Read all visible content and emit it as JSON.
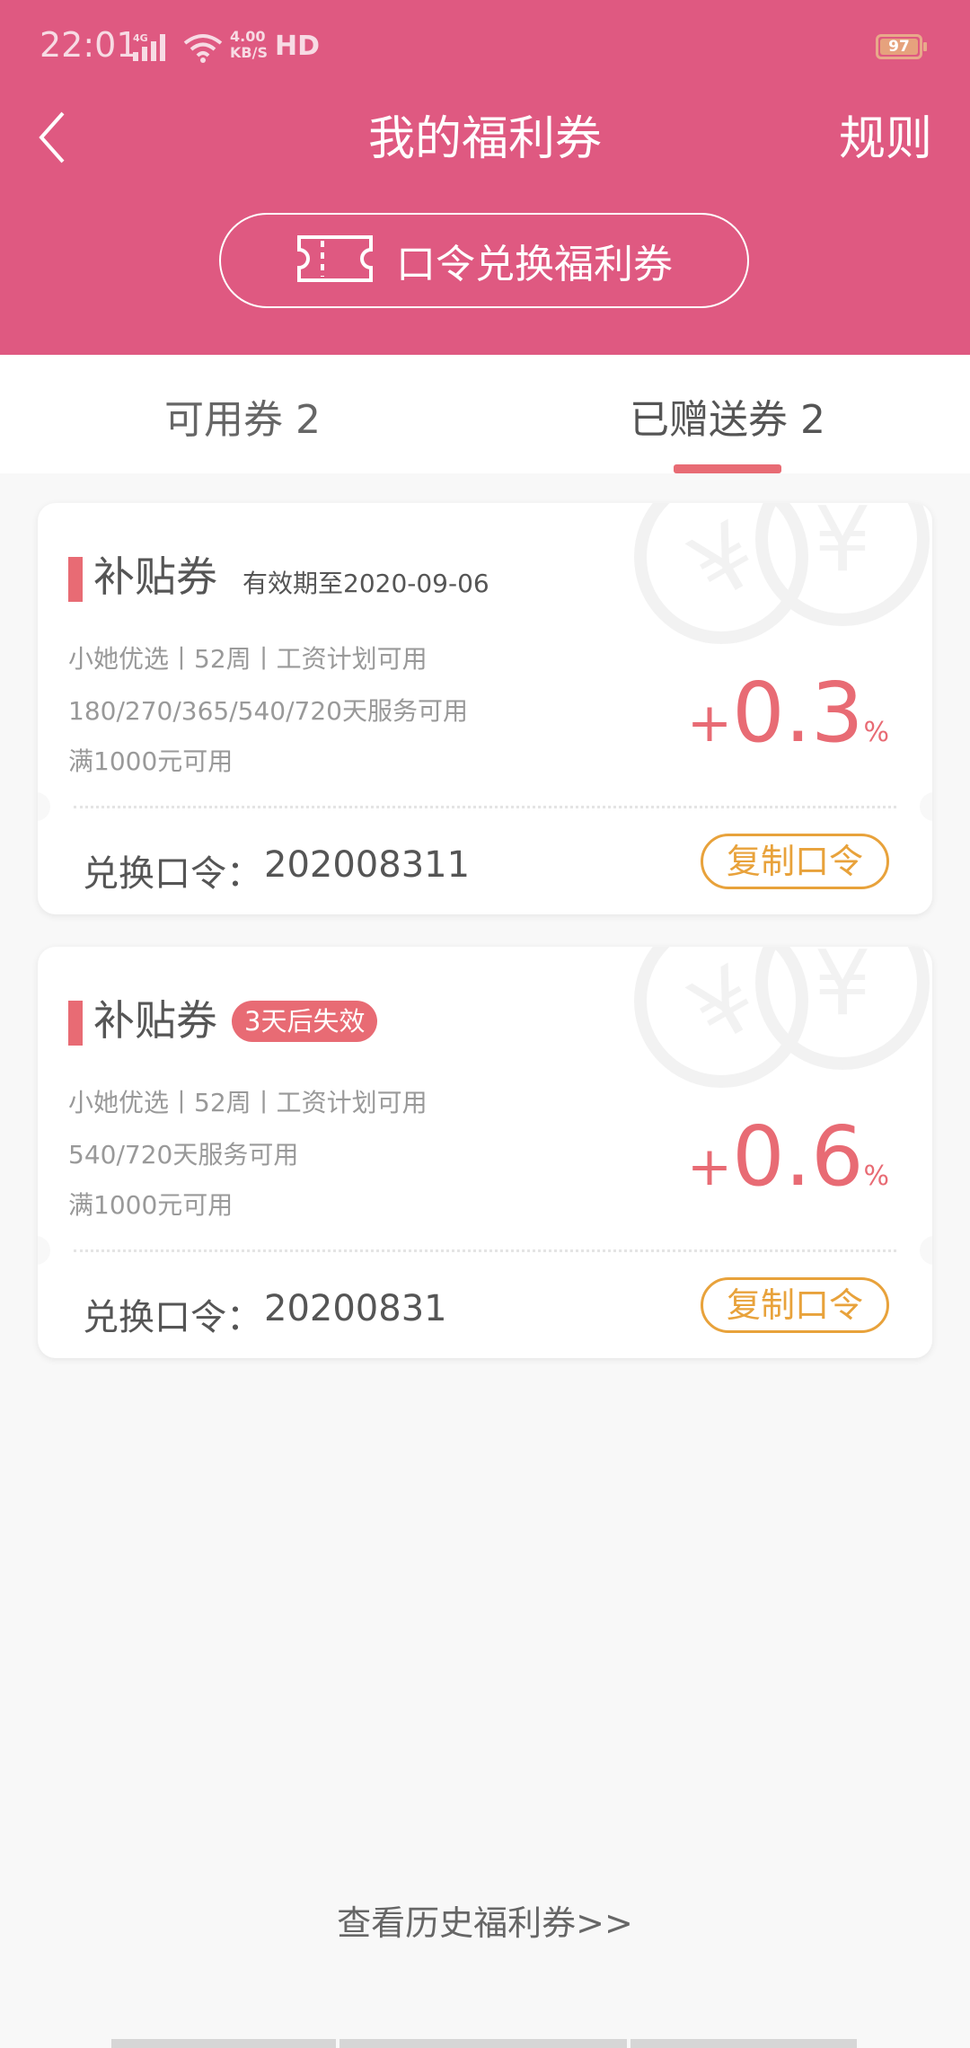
{
  "status_bar": {
    "time": "22:01",
    "net_speed_value": "4.00",
    "net_speed_unit": "KB/S",
    "hd": "HD",
    "battery": "97"
  },
  "header": {
    "title": "我的福利券",
    "rules_label": "规则",
    "redeem_label": "口令兑换福利券",
    "background_color": "#df5981"
  },
  "tabs": [
    {
      "label": "可用券 2",
      "active": false
    },
    {
      "label": "已赠送券 2",
      "active": true
    }
  ],
  "coupons": [
    {
      "title": "补贴券",
      "validity": "有效期至2020-09-06",
      "badge": "",
      "line1": "小她优选丨52周丨工资计划可用",
      "line2": "180/270/365/540/720天服务可用",
      "line3": "满1000元可用",
      "rate_sign": "+",
      "rate_value": "0.3",
      "rate_unit": "%",
      "code_label": "兑换口令：",
      "code_value": "202008311",
      "copy_label": "复制口令"
    },
    {
      "title": "补贴券",
      "validity": "",
      "badge": "3天后失效",
      "line1": "小她优选丨52周丨工资计划可用",
      "line2": "540/720天服务可用",
      "line3": "满1000元可用",
      "rate_sign": "+",
      "rate_value": "0.6",
      "rate_unit": "%",
      "code_label": "兑换口令：",
      "code_value": "20200831",
      "copy_label": "复制口令"
    }
  ],
  "history_link": "查看历史福利券>>",
  "colors": {
    "accent_red": "#e86b74",
    "copy_orange": "#e8a23b"
  }
}
